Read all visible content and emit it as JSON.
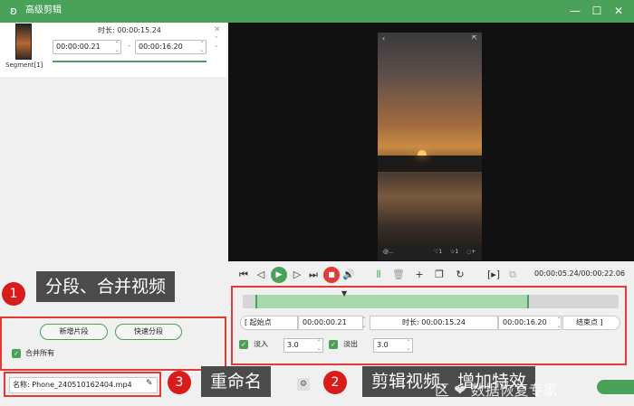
{
  "window": {
    "title": "高级剪辑",
    "logo_icon": "rabbit-logo-icon",
    "min_glyph": "—",
    "max_glyph": "☐",
    "close_glyph": "✕"
  },
  "segment": {
    "label": "Segment[1]",
    "duration": "时长:  00:00:15.24",
    "start": "00:00:00.21",
    "end": "00:00:16.20",
    "dash": "-"
  },
  "video_overlay": {
    "bottom_text": "@...",
    "likes": "♡1",
    "stars": "☆1",
    "comments": "◌+"
  },
  "controls": {
    "timecode": "00:00:05.24/00:00:22.06"
  },
  "trim": {
    "start_label": "起始点",
    "start_time": "00:00:00.21",
    "duration": "时长:  00:00:15.24",
    "end_time": "00:00:16.20",
    "end_label": "结束点",
    "fade_in_label": "淡入",
    "fade_in_value": "3.0",
    "fade_out_label": "淡出",
    "fade_out_value": "3.0"
  },
  "left_actions": {
    "new_segment": "新增片段",
    "quick_split": "快速分段",
    "merge_all": "合并所有"
  },
  "file": {
    "name_label": "名称:",
    "name_value": "Phone_240510162404.mp4"
  },
  "annotations": {
    "a1_num": "1",
    "a1_text": "分段、合并视频",
    "a2_num": "2",
    "a2_text": "剪辑视频、增加特效",
    "a3_num": "3",
    "a3_text": "重命名"
  },
  "watermark": "区 ❤ 数据恢复专家",
  "colors": {
    "accent": "#4aa159",
    "annotation_red": "#e53935",
    "callout_bg": "#4b4b4b"
  }
}
